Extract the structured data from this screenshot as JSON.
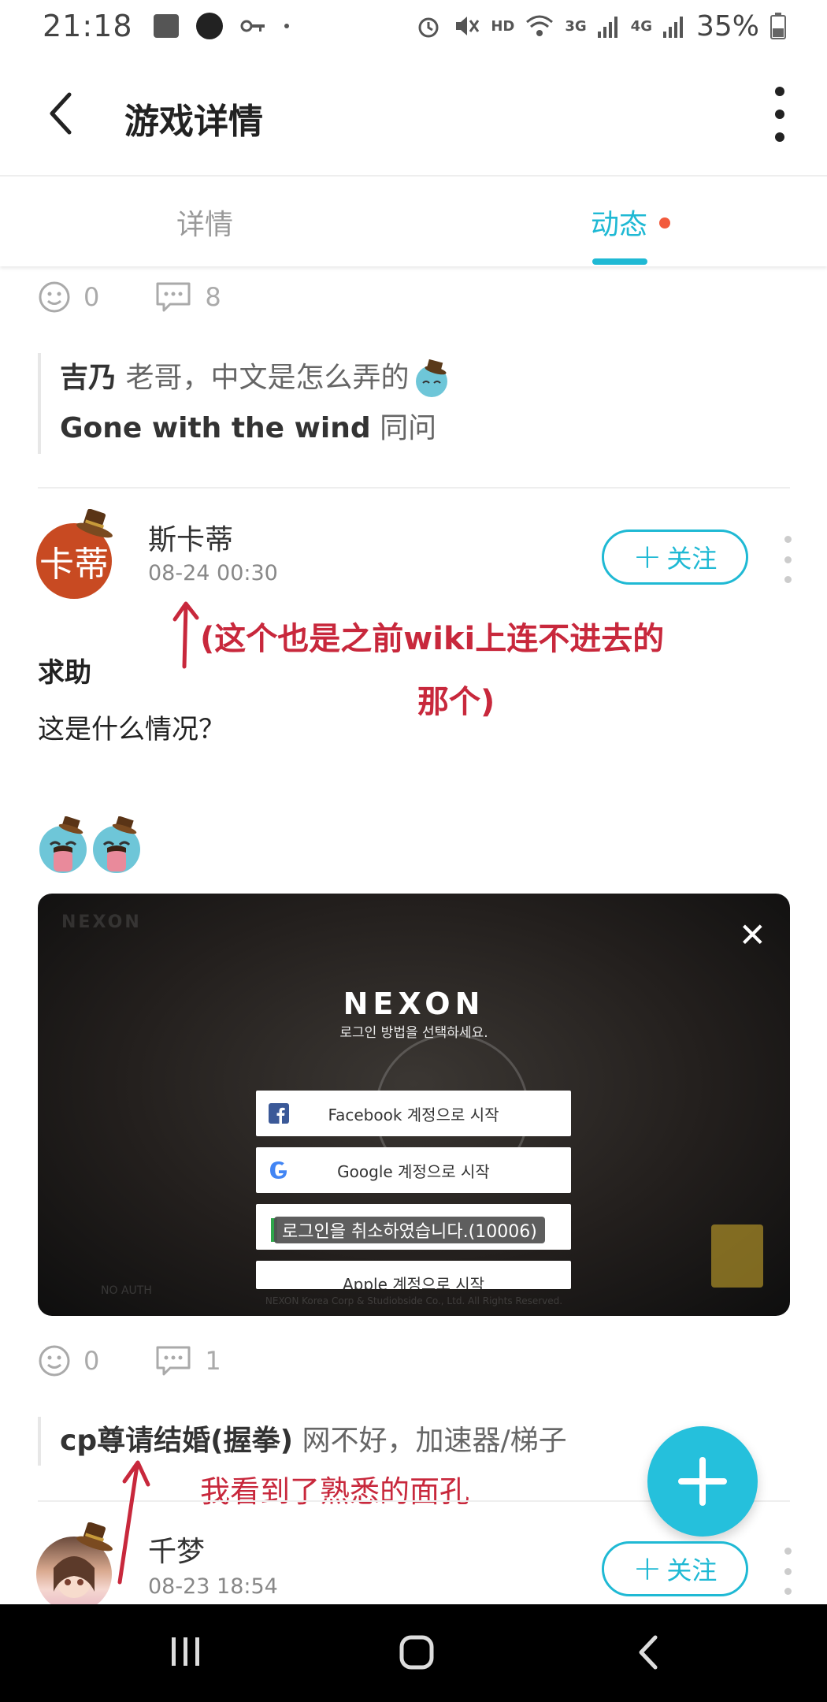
{
  "status_bar": {
    "time": "21:18",
    "network_label": "HD",
    "net_3g": "3G",
    "net_4g": "4G",
    "battery": "35%"
  },
  "header": {
    "title": "游戏详情"
  },
  "tabs": {
    "detail": "详情",
    "dynamics": "动态"
  },
  "post_top": {
    "likes": "0",
    "comments": "8"
  },
  "quote1": {
    "line1_user": "吉乃",
    "line1_text": " 老哥，中文是怎么弄的",
    "line2_user": "Gone with the wind",
    "line2_text": " 同问"
  },
  "post": {
    "avatar_text": "卡蒂",
    "username": "斯卡蒂",
    "date": "08-24 00:30",
    "follow_label": "关注",
    "title": "求助",
    "body": "这是什么情况？",
    "likes": "0",
    "comments": "1"
  },
  "annotation": {
    "line1": "(这个也是之前wiki上连不进去的",
    "line2": "那个)",
    "line3": "我看到了熟悉的面孔"
  },
  "screenshot": {
    "brand": "NEXON",
    "subtitle": "로그인 방법을 선택하세요.",
    "buttons": [
      "Facebook 계정으로 시작",
      "Google 계정으로 시작",
      "",
      "Apple 계정으로 시작"
    ],
    "toast": "로그인을 취소하였습니다.(10006)",
    "footer": "NEXON Korea Corp & Studiobside Co., Ltd. All Rights Reserved.",
    "corner_logo": "NEXON",
    "no_auth": "NO AUTH"
  },
  "quote2": {
    "user": "cp尊请结婚(握拳)",
    "text": " 网不好，加速器/梯子"
  },
  "post2": {
    "username": "千梦",
    "date": "08-23 18:54",
    "follow_label": "关注"
  },
  "colors": {
    "accent": "#1fb9d4",
    "annotation": "#c8283c",
    "badge": "#f25a3c"
  }
}
